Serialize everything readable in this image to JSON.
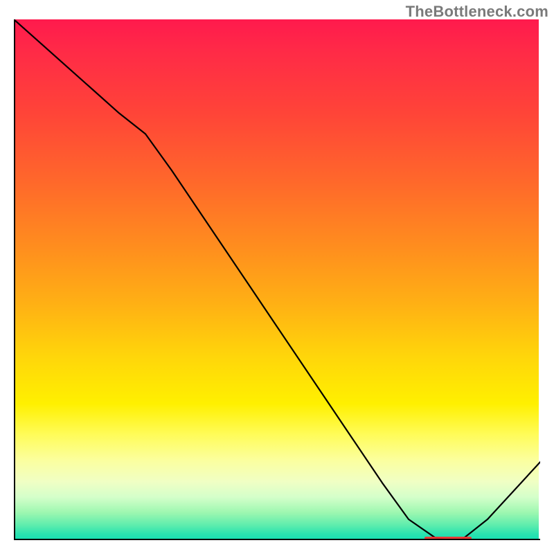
{
  "watermark": "TheBottleneck.com",
  "chart_data": {
    "type": "line",
    "x": [
      0.0,
      0.05,
      0.1,
      0.15,
      0.2,
      0.25,
      0.3,
      0.35,
      0.4,
      0.45,
      0.5,
      0.55,
      0.6,
      0.65,
      0.7,
      0.75,
      0.8,
      0.825,
      0.85,
      0.9,
      0.95,
      1.0
    ],
    "values": [
      1.0,
      0.955,
      0.91,
      0.865,
      0.82,
      0.78,
      0.71,
      0.635,
      0.56,
      0.485,
      0.41,
      0.335,
      0.26,
      0.185,
      0.11,
      0.04,
      0.005,
      0.0,
      0.0,
      0.04,
      0.095,
      0.15
    ],
    "minimum_plateau_x": [
      0.78,
      0.87
    ],
    "xlim": [
      0,
      1
    ],
    "ylim": [
      0,
      1
    ],
    "background": "rainbow-gradient",
    "title": "",
    "xlabel": "",
    "ylabel": ""
  }
}
